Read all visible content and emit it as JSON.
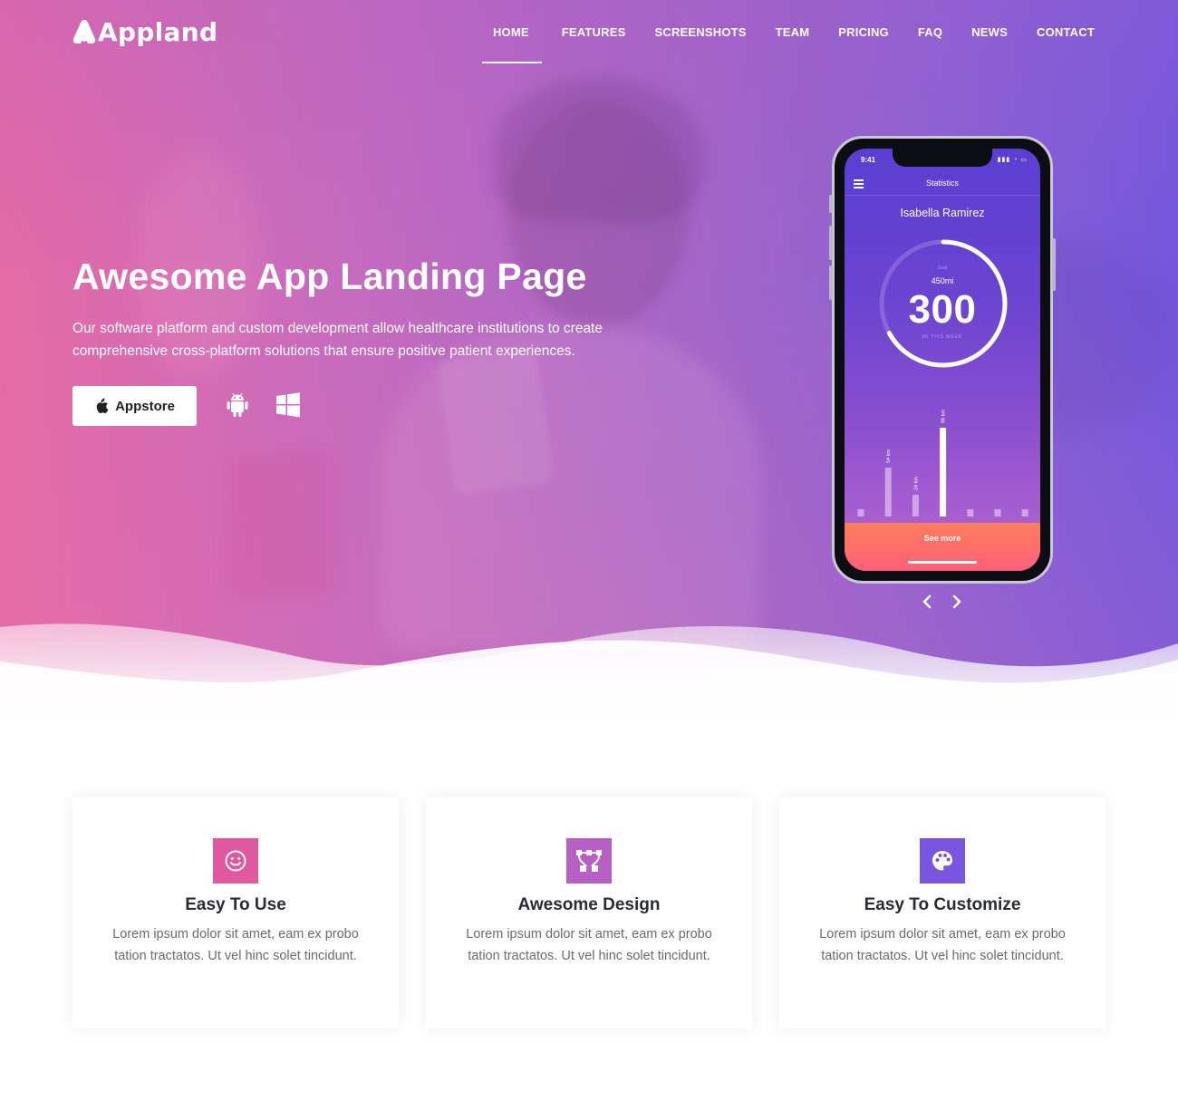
{
  "brand": {
    "name": "Appland"
  },
  "nav": {
    "items": [
      {
        "label": "HOME",
        "active": true
      },
      {
        "label": "FEATURES",
        "active": false
      },
      {
        "label": "SCREENSHOTS",
        "active": false
      },
      {
        "label": "TEAM",
        "active": false
      },
      {
        "label": "PRICING",
        "active": false
      },
      {
        "label": "FAQ",
        "active": false
      },
      {
        "label": "NEWS",
        "active": false
      },
      {
        "label": "CONTACT",
        "active": false
      }
    ]
  },
  "hero": {
    "title": "Awesome App Landing Page",
    "description": "Our software platform and custom development allow healthcare institutions to create comprehensive cross-platform solutions that ensure positive patient experiences.",
    "appstore_label": "Appstore",
    "store_icons": [
      "apple-icon",
      "android-icon",
      "windows-icon"
    ]
  },
  "phone": {
    "status_time": "9:41",
    "app_title": "Statistics",
    "user_name": "Isabella Ramirez",
    "goal_label": "Goal",
    "goal_value": "450mi",
    "main_value": "300",
    "main_sub": "MI THIS WEEK",
    "progress": 0.67,
    "days": [
      {
        "day": "M",
        "value": 0,
        "label": ""
      },
      {
        "day": "T",
        "value": 54,
        "label": "54 km"
      },
      {
        "day": "W",
        "value": 24,
        "label": "24 km"
      },
      {
        "day": "T",
        "value": 98,
        "label": "98 km"
      },
      {
        "day": "F",
        "value": 0,
        "label": ""
      },
      {
        "day": "S",
        "value": 0,
        "label": ""
      },
      {
        "day": "S",
        "value": 0,
        "label": ""
      }
    ],
    "see_more": "See more"
  },
  "slider": {
    "prev_icon": "chevron-left-icon",
    "next_icon": "chevron-right-icon"
  },
  "features": [
    {
      "title": "Easy To Use",
      "text": "Lorem ipsum dolor sit amet, eam ex probo tation tractatos. Ut vel hinc solet tincidunt.",
      "icon": "smile-icon",
      "color": "#e0589f"
    },
    {
      "title": "Awesome Design",
      "text": "Lorem ipsum dolor sit amet, eam ex probo tation tractatos. Ut vel hinc solet tincidunt.",
      "icon": "vector-icon",
      "color": "#b85fc4"
    },
    {
      "title": "Easy To Customize",
      "text": "Lorem ipsum dolor sit amet, eam ex probo tation tractatos. Ut vel hinc solet tincidunt.",
      "icon": "palette-icon",
      "color": "#7a55e0"
    }
  ],
  "colors": {
    "hero_start": "#e56ba6",
    "hero_end": "#7258de",
    "accent_orange": "#ff7e5c"
  }
}
